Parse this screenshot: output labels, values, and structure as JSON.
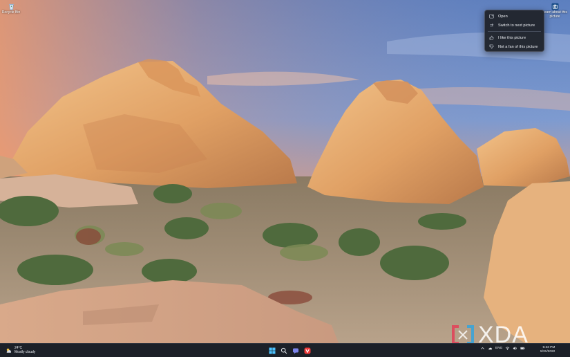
{
  "desktop": {
    "icons": [
      {
        "label": "Recycle Bin"
      },
      {
        "label": "Learn about this picture"
      }
    ]
  },
  "context_menu": {
    "items": [
      {
        "label": "Open",
        "icon": "open-icon"
      },
      {
        "label": "Switch to next picture",
        "icon": "switch-icon"
      },
      {
        "label": "I like this picture",
        "icon": "thumbs-up-icon"
      },
      {
        "label": "Not a fan of this picture",
        "icon": "thumbs-down-icon"
      }
    ]
  },
  "watermark": {
    "text": "XDA",
    "color": "#ffffff"
  },
  "taskbar": {
    "weather": {
      "temp": "24°C",
      "condition": "Mostly cloudy"
    },
    "apps": [
      "start-icon",
      "search-icon",
      "chat-icon",
      "vivaldi-icon"
    ],
    "tray": {
      "lang": "ENG"
    },
    "clock": {
      "time": "5:23 PM",
      "date": "5/31/2022"
    }
  },
  "colors": {
    "taskbar": "#1c2028",
    "menu_bg": "#20242c",
    "accent": "#0078d4"
  }
}
